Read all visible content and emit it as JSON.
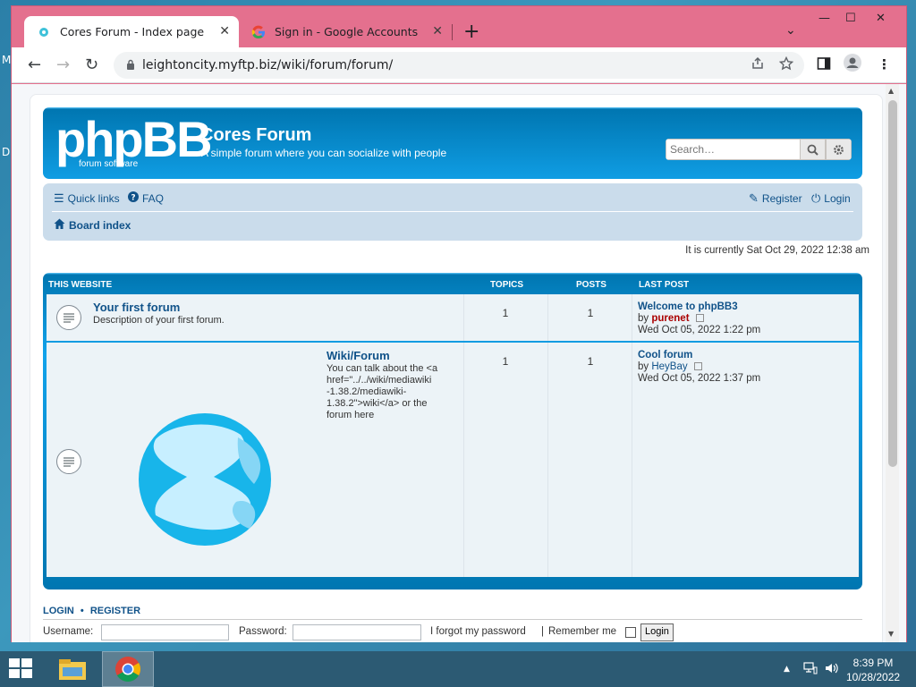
{
  "desktop": {
    "letter_m": "M",
    "letter_d": "D"
  },
  "browser": {
    "tabs": [
      {
        "title": "Cores Forum - Index page",
        "close": "✕"
      },
      {
        "title": "Sign in - Google Accounts",
        "close": "✕"
      }
    ],
    "new_tab": "+",
    "tab_search": "⌄",
    "window_controls": {
      "minimize": "—",
      "maximize": "☐",
      "close": "✕"
    },
    "nav": {
      "back": "←",
      "forward": "→",
      "reload": "↻"
    },
    "url": "leightoncity.myftp.biz/wiki/forum/forum/"
  },
  "site": {
    "logo_text": "phpBB",
    "logo_sub": "forum software",
    "title": "Cores Forum",
    "description": "A simple forum where you can socialize with people",
    "search_placeholder": "Search…"
  },
  "navbar": {
    "quick_links": "Quick links",
    "faq": "FAQ",
    "register": "Register",
    "login": "Login",
    "board_index": "Board index"
  },
  "datetime": "It is currently Sat Oct 29, 2022 12:38 am",
  "forums_table": {
    "headers": {
      "category": "THIS WEBSITE",
      "topics": "TOPICS",
      "posts": "POSTS",
      "last_post": "LAST POST"
    },
    "rows": [
      {
        "title": "Your first forum",
        "description": "Description of your first forum.",
        "topics": "1",
        "posts": "1",
        "last_post_title": "Welcome to phpBB3",
        "by": "by",
        "author": "purenet",
        "date": "Wed Oct 05, 2022 1:22 pm"
      },
      {
        "title": "Wiki/Forum",
        "description_lines": [
          "You can talk about the <a",
          "href=\"../../wiki/mediawiki",
          "-1.38.2/mediawiki-",
          "1.38.2\">wiki</a> or the",
          "forum here"
        ],
        "topics": "1",
        "posts": "1",
        "last_post_title": "Cool forum",
        "by": "by",
        "author": "HeyBay",
        "date": "Wed Oct 05, 2022 1:37 pm"
      }
    ]
  },
  "login": {
    "login_label": "LOGIN",
    "bullet": "•",
    "register_label": "REGISTER",
    "username_label": "Username:",
    "password_label": "Password:",
    "forgot": "I forgot my password",
    "separator": "|",
    "remember": "Remember me",
    "button": "Login"
  },
  "taskbar": {
    "time": "8:39 PM",
    "date": "10/28/2022"
  }
}
